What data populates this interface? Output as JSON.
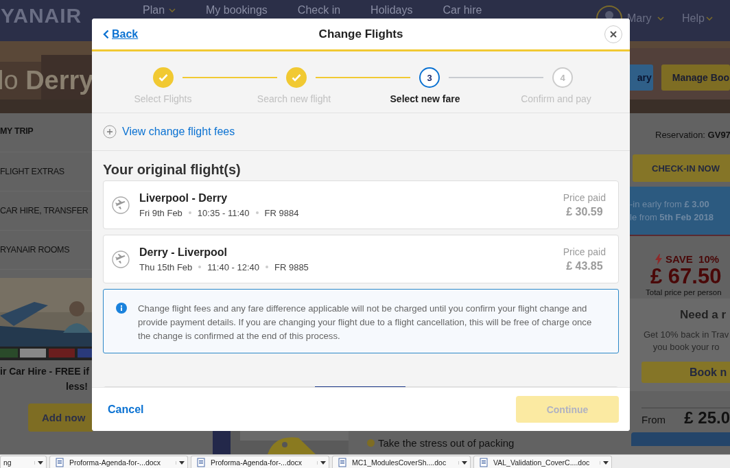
{
  "header": {
    "logo": "YANAIR",
    "nav": [
      {
        "label": "Plan",
        "dropdown": true
      },
      {
        "label": "My bookings",
        "dropdown": false
      },
      {
        "label": "Check in",
        "dropdown": false
      },
      {
        "label": "Holidays",
        "dropdown": false
      },
      {
        "label": "Car hire",
        "dropdown": false
      }
    ],
    "user": "Mary",
    "help": "Help"
  },
  "hero": {
    "greeting": "lo **Derry**",
    "buttons": [
      {
        "label": "ary",
        "kind": "blue"
      },
      {
        "label": "Manage Boo",
        "kind": "yellow"
      }
    ]
  },
  "sidebar": {
    "items": [
      {
        "label": "MY TRIP",
        "selected": true
      },
      {
        "label": "FLIGHT EXTRAS",
        "selected": false
      },
      {
        "label": "CAR HIRE, TRANSFER",
        "selected": false
      },
      {
        "label": "RYANAIR ROOMS",
        "selected": false
      }
    ],
    "promo_lines": [
      "ir Car Hire -  FREE if",
      "less!"
    ],
    "promo_button": "Add now"
  },
  "center": {
    "bullet": "Take the stress out of packing"
  },
  "right": {
    "reservation": "Reservation: **GV97**",
    "checkin_button": "CHECK-IN NOW",
    "checkin_info": [
      "-in early from **£ 3.00**",
      "le from **5th Feb 2018**"
    ],
    "save": "SAVE  10%",
    "price": "£ 67.50",
    "price_note": "Total price per person",
    "rooms_title": "Need a r",
    "rooms_text": [
      "Get 10% back in Trav",
      "you book your ro"
    ],
    "rooms_button": "Book n",
    "from_label": "From",
    "from_price": "£ 25.0"
  },
  "modal": {
    "back": "Back",
    "title": "Change Flights",
    "steps": [
      {
        "label": "Select Flights",
        "kind": "done"
      },
      {
        "label": "Search new flight",
        "kind": "done"
      },
      {
        "number": "3",
        "label": "Select new fare",
        "kind": "current"
      },
      {
        "number": "4",
        "label": "Confirm and pay",
        "kind": "upcoming"
      }
    ],
    "fees_link": "View change flight fees",
    "section_title": "Your original flight(s)",
    "flights": [
      {
        "route": "Liverpool - Derry",
        "date": "Fri 9th Feb",
        "time": "10:35 - 11:40",
        "flight": "FR 9884",
        "price_label": "Price paid",
        "price": "£ 30.59"
      },
      {
        "route": "Derry - Liverpool",
        "date": "Thu 15th Feb",
        "time": "11:40 - 12:40",
        "flight": "FR 9885",
        "price_label": "Price paid",
        "price": "£ 43.85"
      }
    ],
    "info": "Change flight fees and any fare difference applicable will not be charged until you confirm your flight change and provide payment details. If you are changing your flight due to a flight cancellation, this will be free of charge once the change is confirmed at the end of this process.",
    "cancel": "Cancel",
    "continue": "Continue",
    "continue_disabled": true
  },
  "taskbar": [
    "ng",
    "Proforma-Agenda-for-...docx",
    "Proforma-Agenda-for-...docx",
    "MC1_ModulesCoverSh....doc",
    "VAL_Validation_CoverC....doc"
  ]
}
